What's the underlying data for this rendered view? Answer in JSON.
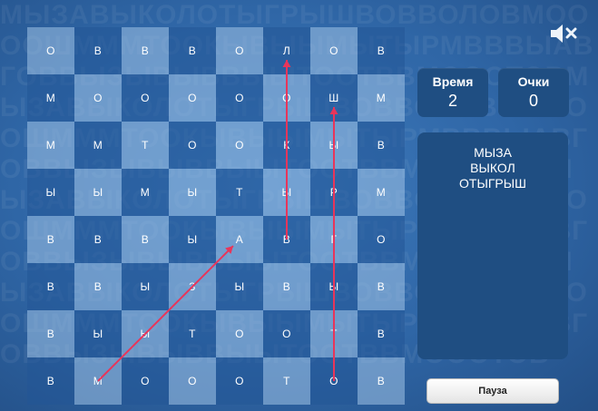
{
  "background_letters": "МЫЗАВЫКОЛОТЫГРЫШВОВВОЛОВМООООШМММТООКЫВЫЫМЫТЫРМВВВЫАВГОВВЫЗЫВЫВВЫЫТООТВВМОООТОВМЫЗАВЫКОЛОТЫГРЫШВОВВОЛОВМООООШМММТООКЫВЫЫМЫТЫРМВВВЫАВГОВВЫЗЫВЫВВЫЫТООТВВМОООТОВМЫЗАВЫКОЛОТЫГРЫШВОВВОЛОВМООООШМММТООКЫВЫЫМЫТЫРМВВВЫАВГОВВЫЗЫВЫВВЫЫТООТВВМОООТОВМЫЗАВЫКОЛОТЫГРЫШВОВВОЛОВМООООШМММТООКЫВЫЫМЫТЫРМВВВЫАВГОВВЫЗЫВЫВВЫЫТООТВВМОООТОВ",
  "board": {
    "rows": [
      [
        "О",
        "В",
        "В",
        "В",
        "О",
        "Л",
        "О",
        "В"
      ],
      [
        "М",
        "О",
        "О",
        "О",
        "О",
        "О",
        "Ш",
        "М"
      ],
      [
        "М",
        "М",
        "Т",
        "О",
        "О",
        "К",
        "Ы",
        "В"
      ],
      [
        "Ы",
        "Ы",
        "М",
        "Ы",
        "Т",
        "Ы",
        "Р",
        "М"
      ],
      [
        "В",
        "В",
        "В",
        "Ы",
        "А",
        "В",
        "Г",
        "О"
      ],
      [
        "В",
        "В",
        "Ы",
        "З",
        "Ы",
        "В",
        "Ы",
        "В"
      ],
      [
        "В",
        "Ы",
        "Ы",
        "Т",
        "О",
        "О",
        "Т",
        "В"
      ],
      [
        "В",
        "М",
        "О",
        "О",
        "О",
        "Т",
        "О",
        "В"
      ]
    ]
  },
  "arrows": [
    {
      "from": [
        7,
        1
      ],
      "to": [
        4,
        4
      ]
    },
    {
      "from": [
        4,
        5
      ],
      "to": [
        0,
        5
      ]
    },
    {
      "from": [
        7,
        6
      ],
      "to": [
        1,
        6
      ]
    }
  ],
  "colors": {
    "arrow": "#e8355a"
  },
  "sound": {
    "icon": "speaker-muted-icon"
  },
  "time": {
    "label": "Время",
    "value": "2"
  },
  "score": {
    "label": "Очки",
    "value": "0"
  },
  "words": [
    "МЫЗА",
    "ВЫКОЛ",
    "ОТЫГРЫШ"
  ],
  "pause": {
    "label": "Пауза"
  }
}
